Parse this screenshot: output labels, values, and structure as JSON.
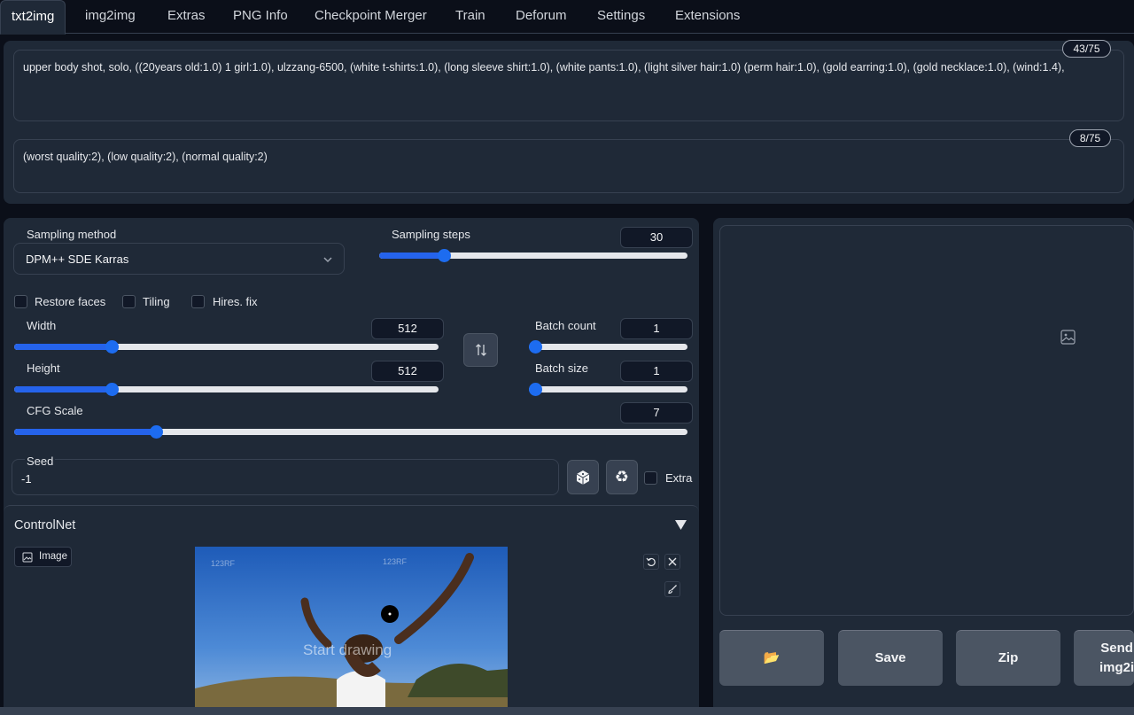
{
  "tabs": [
    "txt2img",
    "img2img",
    "Extras",
    "PNG Info",
    "Checkpoint Merger",
    "Train",
    "Deforum",
    "Settings",
    "Extensions"
  ],
  "prompt": {
    "text": "upper body shot, solo, ((20years old:1.0) 1 girl:1.0), ulzzang-6500, (white t-shirts:1.0), (long sleeve shirt:1.0), (white pants:1.0), (light silver hair:1.0) (perm hair:1.0), (gold earring:1.0), (gold necklace:1.0), (wind:1.4),",
    "counter": "43/75"
  },
  "negative_prompt": {
    "text": "(worst quality:2), (low quality:2), (normal quality:2)",
    "counter": "8/75"
  },
  "sampling_method": {
    "label": "Sampling method",
    "value": "DPM++ SDE Karras"
  },
  "sampling_steps": {
    "label": "Sampling steps",
    "value": "30",
    "fraction": 0.21
  },
  "checkboxes": {
    "restore_faces": "Restore faces",
    "tiling": "Tiling",
    "hires_fix": "Hires. fix",
    "extra": "Extra"
  },
  "width": {
    "label": "Width",
    "value": "512",
    "fraction": 0.23
  },
  "height": {
    "label": "Height",
    "value": "512",
    "fraction": 0.23
  },
  "batch_count": {
    "label": "Batch count",
    "value": "1",
    "fraction": 0.0
  },
  "batch_size": {
    "label": "Batch size",
    "value": "1",
    "fraction": 0.0
  },
  "cfg_scale": {
    "label": "CFG Scale",
    "value": "7",
    "fraction": 0.21
  },
  "seed": {
    "label": "Seed",
    "value": "-1"
  },
  "controlnet": {
    "title": "ControlNet",
    "image_tab": "Image",
    "canvas_hint": "Start drawing",
    "watermark": "123RF"
  },
  "output_buttons": {
    "folder": "📂",
    "save": "Save",
    "zip": "Zip",
    "send": "Send\nimg2i"
  },
  "icons": [
    "swap-icon",
    "dice-icon",
    "recycle-icon",
    "image-placeholder-icon",
    "undo-icon",
    "close-icon",
    "brush-icon",
    "collapse-triangle-icon",
    "chevron-down-icon",
    "folder-icon"
  ],
  "colors": {
    "accent": "#2563eb",
    "background": "#0b0f19",
    "panel": "#1f2937"
  }
}
